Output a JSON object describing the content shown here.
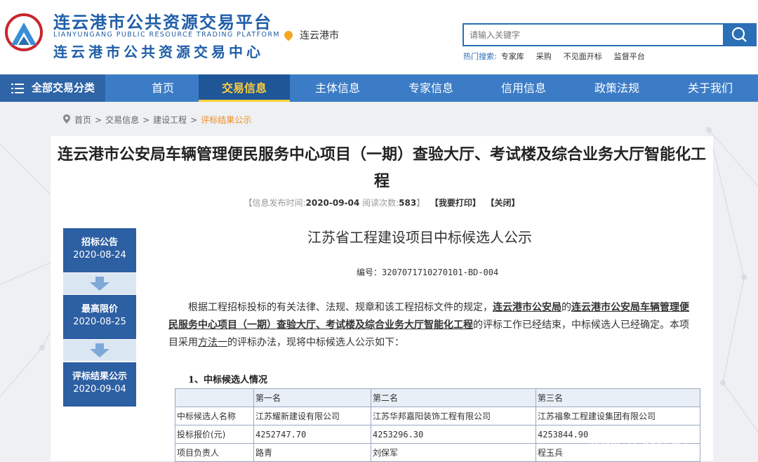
{
  "header": {
    "site_title": "连云港市公共资源交易平台",
    "site_subtitle": "LIANYUNGANG PUBLIC RESOURCE TRADING PLATFORM",
    "site_center": "连云港市公共资源交易中心",
    "location": "连云港市",
    "search_placeholder": "请输入关键字",
    "hot_label": "热门搜索:",
    "hot_items": [
      "专家库",
      "采购",
      "不见面开标",
      "监督平台"
    ]
  },
  "nav": {
    "category": "全部交易分类",
    "items": [
      "首页",
      "交易信息",
      "主体信息",
      "专家信息",
      "信用信息",
      "政策法规",
      "关于我们"
    ],
    "active": "交易信息"
  },
  "breadcrumb": [
    "首页",
    "交易信息",
    "建设工程",
    "评标结果公示"
  ],
  "article": {
    "title": "连云港市公安局车辆管理便民服务中心项目（一期）查验大厅、考试楼及综合业务大厅智能化工程",
    "meta_prefix": "【信息发布时间:",
    "publish_date": "2020-09-04",
    "read_label": "阅读次数:",
    "read_count": "583",
    "meta_suffix": "】",
    "print_label": "【我要打印】",
    "close_label": "【关闭】"
  },
  "timeline": [
    {
      "label": "招标公告",
      "date": "2020-08-24"
    },
    {
      "label": "最高限价",
      "date": "2020-08-25"
    },
    {
      "label": "评标结果公示",
      "date": "2020-09-04"
    }
  ],
  "doc": {
    "title": "江苏省工程建设项目中标候选人公示",
    "code": "编号：3207071710270101-BD-004",
    "para_1": "根据工程招标投标的有关法律、法规、规章和该工程招标文件的规定，",
    "tenderer": "连云港市公安局",
    "para_2": "的",
    "project": "连云港市公安局车辆管理便民服务中心项目（一期）查验大厅、考试楼及综合业务大厅智能化工程",
    "para_3": "的评标工作已经结束，中标候选人已经确定。本项目采用",
    "method": "方法一",
    "para_4": "的评标办法，现将中标候选人公示如下：",
    "section_1": "1、中标候选人情况"
  },
  "table": {
    "header": [
      "",
      "第一名",
      "第二名",
      "第三名"
    ],
    "rows": [
      [
        "中标候选人名称",
        "江苏耀新建设有限公司",
        "江苏华邦嘉阳装饰工程有限公司",
        "江苏福象工程建设集团有限公司"
      ],
      [
        "投标报价(元)",
        "4252747.70",
        "4253296.30",
        "4253844.90"
      ],
      [
        "项目负责人",
        "路青",
        "刘保军",
        "程玉兵"
      ]
    ]
  },
  "watermark": "招标 江苏建吧",
  "colors": {
    "primary": "#2b6fb6",
    "nav": "#3c7cc6",
    "active_text": "#ffcf3a",
    "timeline": "#2d5fa3",
    "breadcrumb_current": "#f08c1a"
  }
}
